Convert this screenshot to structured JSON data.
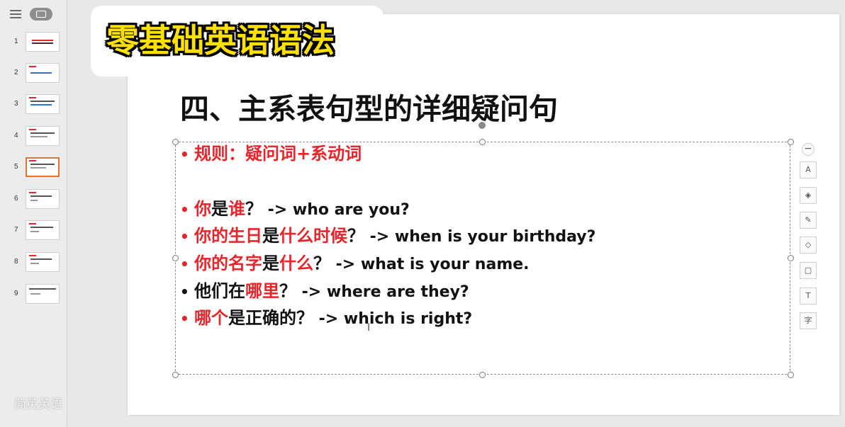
{
  "thumbnails": [
    {
      "num": "1"
    },
    {
      "num": "2"
    },
    {
      "num": "3"
    },
    {
      "num": "4"
    },
    {
      "num": "5"
    },
    {
      "num": "6"
    },
    {
      "num": "7"
    },
    {
      "num": "8"
    },
    {
      "num": "9"
    }
  ],
  "active_slide": 5,
  "overlay_title": "零基础英语语法",
  "slide": {
    "title": "四、主系表句型的详细疑问句",
    "rule": {
      "prefix": "规则：",
      "text": "疑问词+系动词"
    },
    "lines": [
      {
        "s1": "你",
        "s2": "是",
        "s3": "谁",
        "s4": "？",
        "en": " -> who are you?"
      },
      {
        "s1": "你的生日",
        "s2": "是",
        "s3": "什么时候",
        "s4": "？",
        "en": " -> when is your birthday?"
      },
      {
        "s1": "你的名字",
        "s2": "是",
        "s3": "什么",
        "s4": "？",
        "en": " -> what is your name."
      },
      {
        "s1": "他们在",
        "s3": "哪里",
        "s4": "？",
        "en": " -> where are they?"
      },
      {
        "s1": "哪个",
        "s2": "是正确的",
        "s4": "？",
        "en": " -> which is right?"
      }
    ]
  },
  "toolbar": [
    {
      "icon": "collapse-icon",
      "glyph": "−"
    },
    {
      "icon": "text-style-icon",
      "glyph": "A"
    },
    {
      "icon": "layers-icon",
      "glyph": "◈"
    },
    {
      "icon": "brush-icon",
      "glyph": "✎"
    },
    {
      "icon": "fill-icon",
      "glyph": "◇"
    },
    {
      "icon": "border-icon",
      "glyph": "▢"
    },
    {
      "icon": "text-box-icon",
      "glyph": "T"
    },
    {
      "icon": "font-icon",
      "glyph": "字"
    }
  ],
  "watermark": "简英英语",
  "colors": {
    "accent_red": "#e8252a",
    "overlay_yellow": "#ffe100",
    "active_thumb": "#e2732f"
  }
}
